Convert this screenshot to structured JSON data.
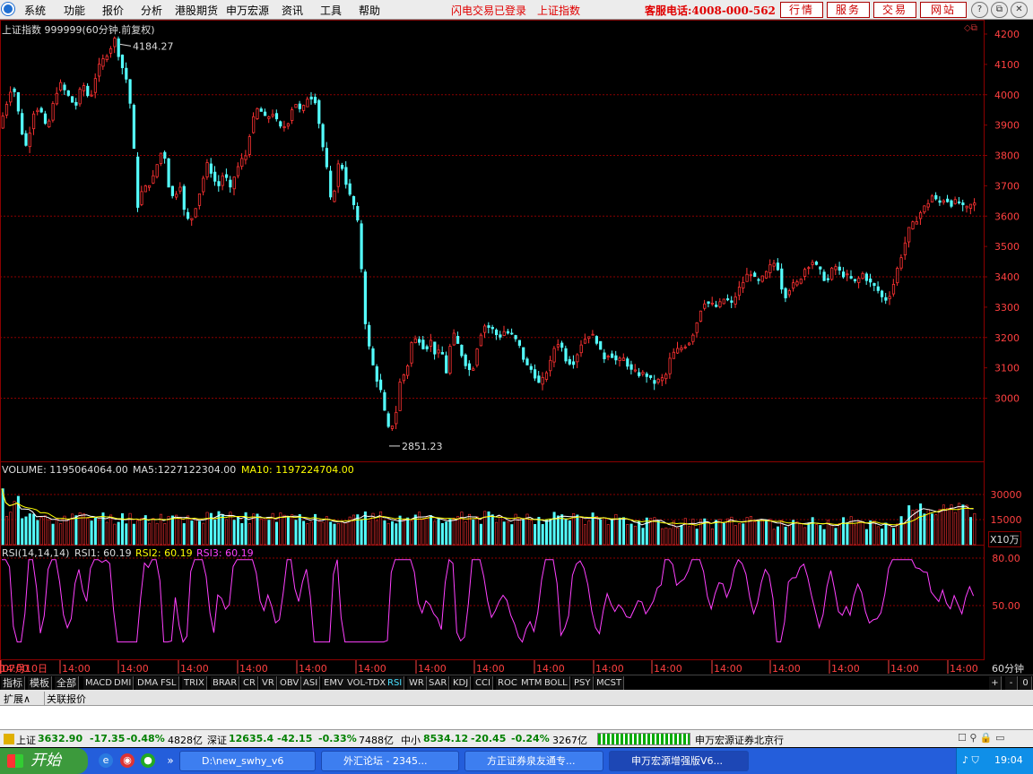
{
  "menu": {
    "items": [
      "系统",
      "功能",
      "报价",
      "分析",
      "港股期货",
      "申万宏源",
      "资讯",
      "工具",
      "帮助"
    ],
    "login_status": "闪电交易已登录",
    "index_name": "上证指数",
    "hotline": "客服电话:4008-000-562",
    "right_buttons": [
      "行情",
      "服务",
      "交易",
      "网站"
    ],
    "window_buttons": [
      "?",
      "⧉",
      "✕"
    ]
  },
  "chart": {
    "title": "上证指数 999999(60分钟.前复权)",
    "high_label": "4184.27",
    "low_label": "2851.23",
    "y_ticks": [
      "4200",
      "4100",
      "4000",
      "3900",
      "3800",
      "3700",
      "3600",
      "3500",
      "3400",
      "3300",
      "3200",
      "3100",
      "3000"
    ],
    "volume": {
      "label": "VOLUME:",
      "value": "1195064064.00",
      "ma5_label": "MA5:",
      "ma5": "1227122304.00",
      "ma10_label": "MA10:",
      "ma10": "1197224704.00",
      "y_ticks": [
        "30000",
        "15000"
      ],
      "unit": "X10万"
    },
    "rsi": {
      "label": "RSI(14,14,14)",
      "rsi1": "RSI1: 60.19",
      "rsi2": "RSI2: 60.19",
      "rsi3": "RSI3: 60.19",
      "y_ticks": [
        "80.00",
        "50.00"
      ]
    },
    "x_ticks": [
      "07月10日",
      "14:00",
      "14:00",
      "14:00",
      "14:00",
      "14:00",
      "14:00",
      "14:00",
      "14:00",
      "14:00",
      "14:00",
      "14:00",
      "14:00",
      "14:00",
      "14:00",
      "14:00",
      "14:00",
      "14:00"
    ],
    "period": "60分钟",
    "colors": {
      "up": "#ff3232",
      "down": "#54ffff",
      "ma5": "#ffffff",
      "ma10": "#ffff00",
      "rsi": "#ff40ff",
      "grid": "#8b0000"
    }
  },
  "chart_data": {
    "type": "candlestick",
    "price_range": [
      2851.23,
      4184.27
    ],
    "notes": "60-minute bars of Shanghai Composite; path approximates plotted closes",
    "path": [
      [
        0,
        3900
      ],
      [
        8,
        3980
      ],
      [
        14,
        4040
      ],
      [
        18,
        3980
      ],
      [
        24,
        3880
      ],
      [
        30,
        3820
      ],
      [
        36,
        3940
      ],
      [
        44,
        3960
      ],
      [
        52,
        3880
      ],
      [
        60,
        3980
      ],
      [
        66,
        4040
      ],
      [
        75,
        4000
      ],
      [
        84,
        3960
      ],
      [
        92,
        4040
      ],
      [
        100,
        3980
      ],
      [
        108,
        4080
      ],
      [
        116,
        4120
      ],
      [
        124,
        4160
      ],
      [
        128,
        4184
      ],
      [
        134,
        4110
      ],
      [
        142,
        4040
      ],
      [
        148,
        3900
      ],
      [
        152,
        3620
      ],
      [
        158,
        3680
      ],
      [
        164,
        3700
      ],
      [
        170,
        3720
      ],
      [
        176,
        3780
      ],
      [
        182,
        3830
      ],
      [
        188,
        3700
      ],
      [
        194,
        3650
      ],
      [
        200,
        3720
      ],
      [
        206,
        3600
      ],
      [
        212,
        3580
      ],
      [
        220,
        3650
      ],
      [
        226,
        3720
      ],
      [
        232,
        3780
      ],
      [
        238,
        3720
      ],
      [
        244,
        3700
      ],
      [
        250,
        3750
      ],
      [
        256,
        3680
      ],
      [
        262,
        3740
      ],
      [
        268,
        3780
      ],
      [
        274,
        3800
      ],
      [
        280,
        3900
      ],
      [
        288,
        3960
      ],
      [
        296,
        3920
      ],
      [
        304,
        3940
      ],
      [
        312,
        3890
      ],
      [
        320,
        3900
      ],
      [
        328,
        3980
      ],
      [
        336,
        3940
      ],
      [
        344,
        4000
      ],
      [
        352,
        3980
      ],
      [
        358,
        3860
      ],
      [
        364,
        3760
      ],
      [
        370,
        3620
      ],
      [
        376,
        3770
      ],
      [
        382,
        3760
      ],
      [
        388,
        3680
      ],
      [
        394,
        3640
      ],
      [
        400,
        3560
      ],
      [
        404,
        3380
      ],
      [
        408,
        3220
      ],
      [
        414,
        3130
      ],
      [
        418,
        3080
      ],
      [
        424,
        3030
      ],
      [
        432,
        2900
      ],
      [
        436,
        2900
      ],
      [
        442,
        2960
      ],
      [
        448,
        3100
      ],
      [
        452,
        3060
      ],
      [
        458,
        3180
      ],
      [
        466,
        3200
      ],
      [
        474,
        3160
      ],
      [
        480,
        3190
      ],
      [
        486,
        3140
      ],
      [
        492,
        3160
      ],
      [
        498,
        3080
      ],
      [
        504,
        3220
      ],
      [
        510,
        3180
      ],
      [
        518,
        3120
      ],
      [
        526,
        3080
      ],
      [
        534,
        3200
      ],
      [
        540,
        3240
      ],
      [
        548,
        3230
      ],
      [
        556,
        3200
      ],
      [
        562,
        3220
      ],
      [
        570,
        3210
      ],
      [
        578,
        3180
      ],
      [
        586,
        3110
      ],
      [
        594,
        3090
      ],
      [
        602,
        3040
      ],
      [
        608,
        3080
      ],
      [
        614,
        3120
      ],
      [
        620,
        3190
      ],
      [
        626,
        3170
      ],
      [
        632,
        3120
      ],
      [
        640,
        3120
      ],
      [
        648,
        3180
      ],
      [
        656,
        3210
      ],
      [
        664,
        3200
      ],
      [
        672,
        3130
      ],
      [
        680,
        3150
      ],
      [
        688,
        3120
      ],
      [
        696,
        3130
      ],
      [
        704,
        3090
      ],
      [
        712,
        3080
      ],
      [
        720,
        3080
      ],
      [
        728,
        3050
      ],
      [
        736,
        3060
      ],
      [
        742,
        3070
      ],
      [
        748,
        3140
      ],
      [
        756,
        3160
      ],
      [
        762,
        3170
      ],
      [
        770,
        3190
      ],
      [
        778,
        3260
      ],
      [
        784,
        3320
      ],
      [
        792,
        3310
      ],
      [
        800,
        3300
      ],
      [
        808,
        3330
      ],
      [
        816,
        3310
      ],
      [
        822,
        3350
      ],
      [
        828,
        3380
      ],
      [
        836,
        3420
      ],
      [
        844,
        3380
      ],
      [
        852,
        3400
      ],
      [
        860,
        3440
      ],
      [
        866,
        3450
      ],
      [
        874,
        3330
      ],
      [
        882,
        3370
      ],
      [
        890,
        3380
      ],
      [
        898,
        3430
      ],
      [
        906,
        3450
      ],
      [
        914,
        3420
      ],
      [
        922,
        3380
      ],
      [
        930,
        3440
      ],
      [
        938,
        3410
      ],
      [
        946,
        3400
      ],
      [
        954,
        3380
      ],
      [
        962,
        3410
      ],
      [
        970,
        3380
      ],
      [
        978,
        3360
      ],
      [
        986,
        3320
      ],
      [
        994,
        3350
      ],
      [
        1000,
        3420
      ],
      [
        1008,
        3500
      ],
      [
        1014,
        3560
      ],
      [
        1020,
        3580
      ],
      [
        1028,
        3620
      ],
      [
        1034,
        3640
      ],
      [
        1040,
        3670
      ],
      [
        1046,
        3640
      ],
      [
        1054,
        3660
      ],
      [
        1060,
        3640
      ],
      [
        1068,
        3650
      ],
      [
        1076,
        3620
      ],
      [
        1084,
        3640
      ]
    ]
  },
  "tabs": [
    "指标",
    "模板",
    "全部",
    "MACD",
    "DMI",
    "DMA",
    "FSL",
    "TRIX",
    "BRAR",
    "CR",
    "VR",
    "OBV",
    "ASI",
    "EMV",
    "VOL-TDX",
    "RSI",
    "WR",
    "SAR",
    "KDJ",
    "CCI",
    "ROC",
    "MTM",
    "BOLL",
    "PSY",
    "MCST"
  ],
  "active_tab": "RSI",
  "tab_controls": [
    "+",
    "-",
    "0"
  ],
  "subtabs": [
    "扩展∧",
    "关联报价"
  ],
  "status": {
    "sh_name": "上证",
    "sh_value": "3632.90",
    "sh_change": "-17.35",
    "sh_pct": "-0.48%",
    "sh_amount": "4828亿",
    "sz_name": "深证",
    "sz_value": "12635.4",
    "sz_change": "-42.15",
    "sz_pct": "-0.33%",
    "sz_amount": "7488亿",
    "zx_name": "中小",
    "zx_value": "8534.12",
    "zx_change": "-20.45",
    "zx_pct": "-0.24%",
    "zx_amount": "3267亿",
    "broker": "申万宏源证券北京行"
  },
  "taskbar": {
    "start": "开始",
    "items": [
      "D:\\new_swhy_v6",
      "外汇论坛 - 2345...",
      "方正证券泉友通专...",
      "申万宏源增强版V6..."
    ],
    "clock": "19:04"
  }
}
